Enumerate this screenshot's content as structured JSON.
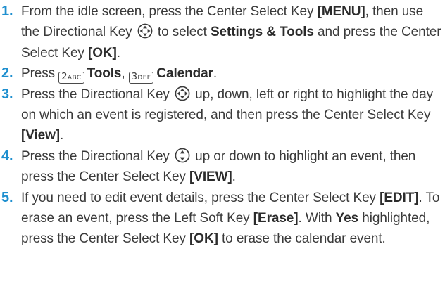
{
  "steps": [
    {
      "number": "1.",
      "t1": "From the idle screen, press the Center Select Key ",
      "b1": "[MENU]",
      "t2": ", then use the Directional Key ",
      "t3": " to select ",
      "b2": "Settings & Tools",
      "t4": " and press the Center Select Key ",
      "b3": "[OK]",
      "t5": "."
    },
    {
      "number": "2.",
      "t1": "Press ",
      "key1_digit": "2",
      "key1_letters": "ABC",
      "b1": "Tools",
      "t2": ", ",
      "key2_digit": "3",
      "key2_letters": "DEF",
      "b2": "Calendar",
      "t3": "."
    },
    {
      "number": "3.",
      "t1": "Press the Directional Key ",
      "t2": " up, down, left or right to highlight the day on which an event is registered, and then press the Center Select Key ",
      "b1": "[View]",
      "t3": "."
    },
    {
      "number": "4.",
      "t1": "Press the Directional Key ",
      "t2": " up or down to highlight an event, then press the Center Select Key ",
      "b1": "[VIEW]",
      "t3": "."
    },
    {
      "number": "5.",
      "t1": "If you need to edit event details, press the Center Select Key ",
      "b1": "[EDIT]",
      "t2": ". To erase an event, press the Left Soft Key ",
      "b2": "[Erase]",
      "t3": ". With ",
      "b3": "Yes",
      "t4": " highlighted, press the Center Select Key ",
      "b4": "[OK]",
      "t5": " to erase the calendar event."
    }
  ],
  "icons": {
    "four_way": "directional-key-four-way-icon",
    "up_down": "directional-key-up-down-icon"
  },
  "colors": {
    "step_number": "#1e8fcf",
    "body_text": "#3a3a3a"
  }
}
